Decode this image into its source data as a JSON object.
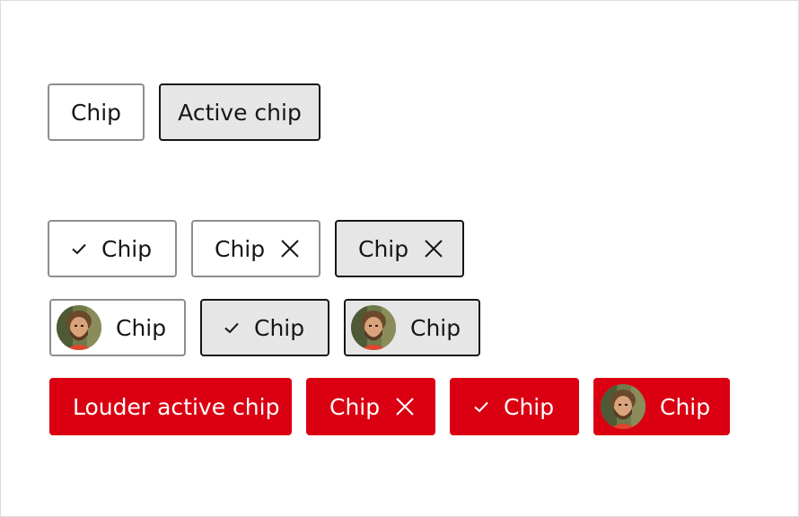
{
  "row1": {
    "chip": "Chip",
    "active_chip": "Active chip"
  },
  "row2": {
    "check_chip": "Chip",
    "dismiss_chip": "Chip",
    "active_dismiss_chip": "Chip"
  },
  "row3": {
    "avatar_chip": "Chip",
    "active_check_chip": "Chip",
    "active_avatar_chip": "Chip"
  },
  "row4": {
    "louder_active_chip": "Louder active chip",
    "louder_dismiss_chip": "Chip",
    "louder_check_chip": "Chip",
    "louder_avatar_chip": "Chip"
  },
  "colors": {
    "accent": "#da0012",
    "border": "#8d8d8d",
    "active_bg": "#e6e6e6",
    "text": "#161616"
  },
  "icons": [
    "checkmark-icon",
    "close-icon",
    "avatar"
  ]
}
